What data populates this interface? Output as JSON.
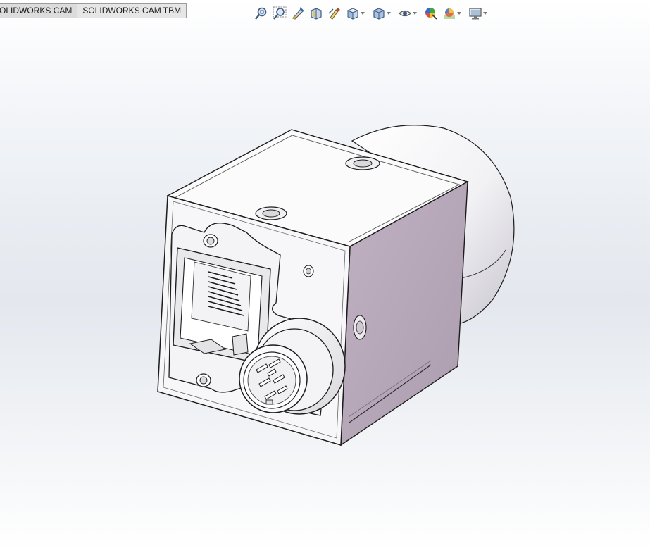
{
  "command_manager": {
    "tabs": [
      {
        "label": "OLIDWORKS CAM"
      },
      {
        "label": "SOLIDWORKS CAM TBM"
      }
    ]
  },
  "heads_up_toolbar": {
    "icons": [
      "zoom-to-fit-icon",
      "zoom-to-area-icon",
      "previous-view-icon",
      "section-view-icon",
      "dynamic-annotation-views-icon",
      "view-orientation-icon",
      "display-style-icon",
      "hide-show-items-icon",
      "edit-appearance-icon",
      "apply-scene-icon",
      "view-settings-icon"
    ]
  },
  "model": {
    "description_name": "industrial-camera-body",
    "shaded_color": "#b8a9bb",
    "body_color": "#f6f6f8",
    "edge_color": "#1c1c1c"
  }
}
